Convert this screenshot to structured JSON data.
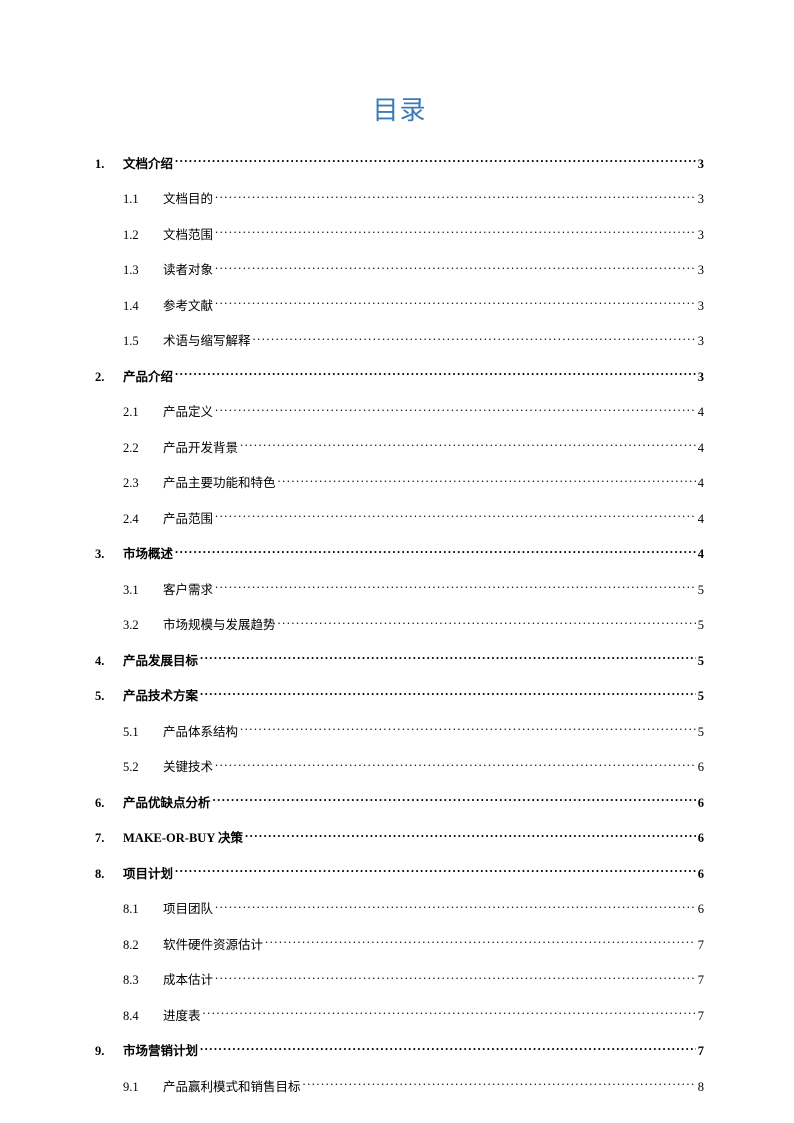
{
  "title": "目录",
  "entries": [
    {
      "level": 1,
      "num": "1.",
      "label": "文档介绍",
      "page": "3"
    },
    {
      "level": 2,
      "num": "1.1",
      "label": "文档目的",
      "page": "3"
    },
    {
      "level": 2,
      "num": "1.2",
      "label": "文档范围",
      "page": "3"
    },
    {
      "level": 2,
      "num": "1.3",
      "label": "读者对象",
      "page": "3"
    },
    {
      "level": 2,
      "num": "1.4",
      "label": "参考文献",
      "page": "3"
    },
    {
      "level": 2,
      "num": "1.5",
      "label": "术语与缩写解释",
      "page": "3"
    },
    {
      "level": 1,
      "num": "2.",
      "label": "产品介绍",
      "page": "3"
    },
    {
      "level": 2,
      "num": "2.1",
      "label": "产品定义",
      "page": "4"
    },
    {
      "level": 2,
      "num": "2.2",
      "label": "产品开发背景",
      "page": "4"
    },
    {
      "level": 2,
      "num": "2.3",
      "label": "产品主要功能和特色",
      "page": "4"
    },
    {
      "level": 2,
      "num": "2.4",
      "label": "产品范围",
      "page": "4"
    },
    {
      "level": 1,
      "num": "3.",
      "label": "市场概述",
      "page": "4"
    },
    {
      "level": 2,
      "num": "3.1",
      "label": "客户需求",
      "page": "5"
    },
    {
      "level": 2,
      "num": "3.2",
      "label": "市场规模与发展趋势",
      "page": "5"
    },
    {
      "level": 1,
      "num": "4.",
      "label": "产品发展目标",
      "page": "5"
    },
    {
      "level": 1,
      "num": "5.",
      "label": "产品技术方案",
      "page": "5"
    },
    {
      "level": 2,
      "num": "5.1",
      "label": "产品体系结构",
      "page": "5"
    },
    {
      "level": 2,
      "num": "5.2",
      "label": "关键技术",
      "page": "6"
    },
    {
      "level": 1,
      "num": "6.",
      "label": "产品优缺点分析",
      "page": "6"
    },
    {
      "level": 1,
      "num": "7.",
      "label": "MAKE-OR-BUY 决策",
      "page": "6"
    },
    {
      "level": 1,
      "num": "8.",
      "label": "项目计划",
      "page": "6"
    },
    {
      "level": 2,
      "num": "8.1",
      "label": "项目团队",
      "page": "6"
    },
    {
      "level": 2,
      "num": "8.2",
      "label": "软件硬件资源估计",
      "page": "7"
    },
    {
      "level": 2,
      "num": "8.3",
      "label": "成本估计",
      "page": "7"
    },
    {
      "level": 2,
      "num": "8.4",
      "label": "进度表",
      "page": "7"
    },
    {
      "level": 1,
      "num": "9.",
      "label": "市场营销计划",
      "page": "7"
    },
    {
      "level": 2,
      "num": "9.1",
      "label": "产品赢利模式和销售目标",
      "page": "8"
    }
  ]
}
